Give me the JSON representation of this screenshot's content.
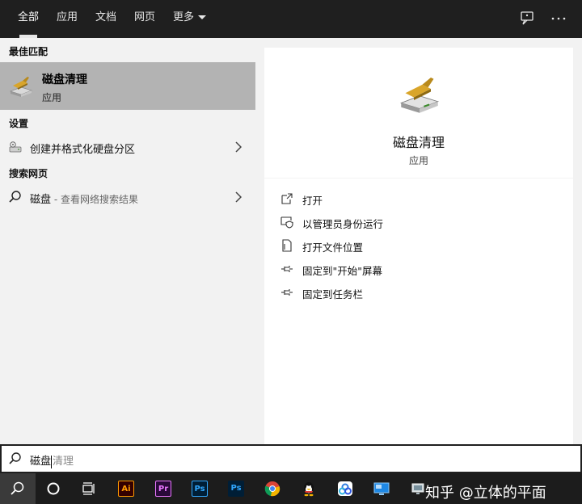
{
  "tabs": [
    {
      "label": "全部"
    },
    {
      "label": "应用"
    },
    {
      "label": "文档"
    },
    {
      "label": "网页"
    },
    {
      "label": "更多"
    }
  ],
  "sections": {
    "best_match": "最佳匹配",
    "settings": "设置",
    "web_search": "搜索网页"
  },
  "best_match": {
    "name": "磁盘清理",
    "kind": "应用"
  },
  "settings_item": {
    "label": "创建并格式化硬盘分区"
  },
  "web_item": {
    "query": "磁盘",
    "suffix": " - 查看网络搜索结果"
  },
  "preview": {
    "name": "磁盘清理",
    "kind": "应用"
  },
  "actions": [
    {
      "label": "打开",
      "icon": "open-icon"
    },
    {
      "label": "以管理员身份运行",
      "icon": "run-as-admin-icon"
    },
    {
      "label": "打开文件位置",
      "icon": "file-location-icon"
    },
    {
      "label": "固定到\"开始\"屏幕",
      "icon": "pin-icon"
    },
    {
      "label": "固定到任务栏",
      "icon": "pin-icon"
    }
  ],
  "search": {
    "typed": "磁盘",
    "hint": "清理"
  },
  "taskbar": {
    "apps": [
      {
        "label": "Ai",
        "color": "#ff9a00",
        "bg": "#330000"
      },
      {
        "label": "Pr",
        "color": "#ea77ff",
        "bg": "#2a0a3a"
      },
      {
        "label": "Ps",
        "color": "#31a8ff",
        "bg": "#001e36"
      },
      {
        "label": "Ps",
        "color": "#31a8ff",
        "bg": "#001e36"
      }
    ]
  },
  "watermark": "知乎 @立体的平面"
}
